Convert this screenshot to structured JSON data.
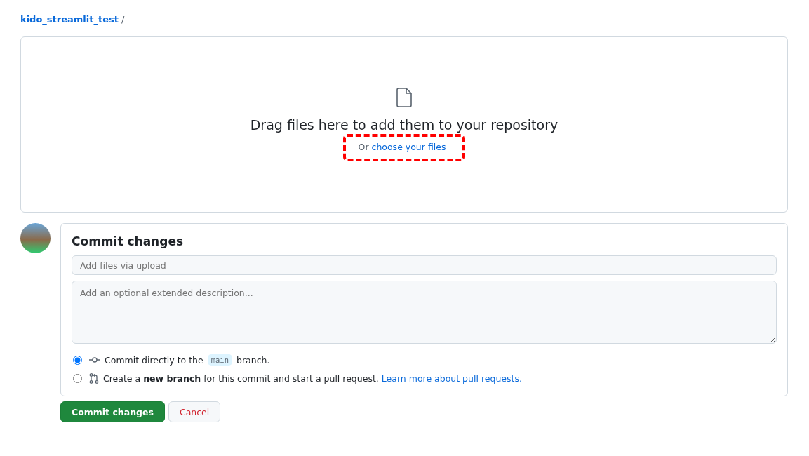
{
  "breadcrumb": {
    "repo": "kido_streamlit_test",
    "separator": "/"
  },
  "dropzone": {
    "title": "Drag files here to add them to your repository",
    "prefix": "Or",
    "link": "choose your files",
    "highlighted": true
  },
  "commit": {
    "heading": "Commit changes",
    "summary": {
      "placeholder": "Add files via upload"
    },
    "description": {
      "placeholder": "Add an optional extended description..."
    },
    "options": [
      {
        "kind": "direct",
        "selected": true,
        "text_before": "Commit directly to the",
        "branch": "main",
        "text_after": "branch."
      },
      {
        "kind": "new_branch",
        "selected": false,
        "text": "Create a **new branch** for this commit and start a pull request.",
        "link": "Learn more about pull requests."
      }
    ]
  },
  "buttons": [
    {
      "kind": "primary",
      "label": "Commit changes"
    },
    {
      "kind": "cancel",
      "label": "Cancel"
    }
  ]
}
